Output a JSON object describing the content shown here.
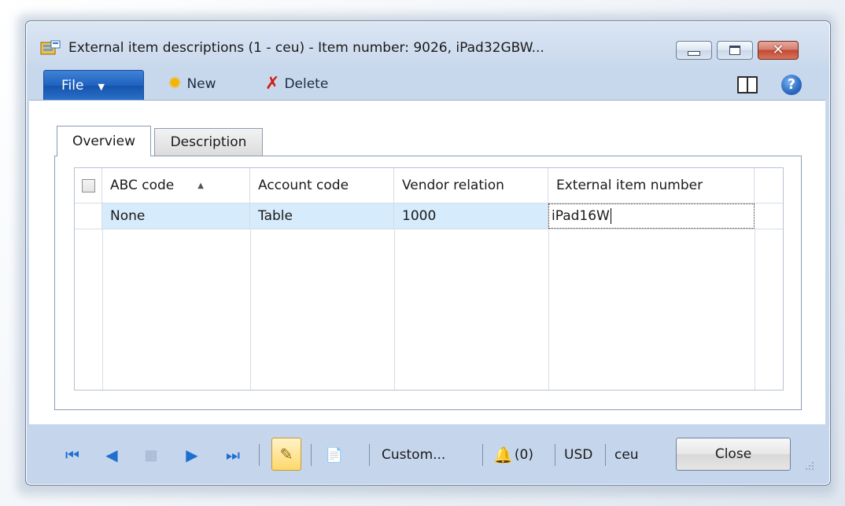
{
  "window": {
    "title": "External item descriptions (1 - ceu) - Item number: 9026, iPad32GBW...",
    "icons": {
      "app": "app-form-icon",
      "minimize": "minimize-icon",
      "maximize": "maximize-icon",
      "close": "close-icon"
    }
  },
  "toolbar": {
    "file_label": "File",
    "new_label": "New",
    "delete_label": "Delete",
    "icons": {
      "new": "new-star-icon",
      "delete": "delete-x-icon",
      "layout": "layout-icon",
      "help": "help-icon"
    }
  },
  "tabs": [
    {
      "label": "Overview",
      "active": true
    },
    {
      "label": "Description",
      "active": false
    }
  ],
  "grid": {
    "columns": [
      "ABC code",
      "Account code",
      "Vendor relation",
      "External item number"
    ],
    "sort_column": "ABC code",
    "sort_direction": "ascending",
    "rows": [
      {
        "abc_code": "None",
        "account_code": "Table",
        "vendor_relation": "1000",
        "external_item_number": "iPad16W"
      }
    ]
  },
  "statusbar": {
    "custom_label": "Custom...",
    "notifications": "(0)",
    "currency": "USD",
    "company": "ceu",
    "close_label": "Close",
    "icons": {
      "first": "first-record-icon",
      "prev": "previous-record-icon",
      "grid": "grid-view-icon",
      "next": "next-record-icon",
      "last": "last-record-icon",
      "edit": "edit-pencil-icon",
      "attach": "attachment-icon",
      "bell": "notification-bell-icon"
    }
  },
  "colors": {
    "accent": "#1f62c0",
    "selection": "#d6ebfb",
    "close_button": "#c24a35"
  }
}
